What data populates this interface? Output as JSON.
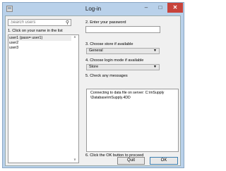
{
  "window": {
    "title": "Log-in",
    "controls": {
      "minimize": "–",
      "maximize": "□",
      "close": "✕"
    }
  },
  "search": {
    "placeholder": "Search users"
  },
  "user_list": {
    "heading": "1. Click on your name in the list",
    "users": [
      "user1 (pass= user1)",
      "user2",
      "user3"
    ],
    "selected_index": 0
  },
  "password": {
    "heading": "2. Enter your password",
    "value": ""
  },
  "store": {
    "heading": "3. Choose store if available",
    "selected": "General"
  },
  "login_mode": {
    "heading": "4. Choose login mode if available",
    "selected": "Store"
  },
  "messages": {
    "heading": "5. Check any messages",
    "lines": [
      "Connecting to data file on server: C:\\mSupply",
      "\\Database\\mSupply.4DD"
    ]
  },
  "footer": {
    "instruction": "6. Click the OK button to proceed",
    "quit_label": "Quit",
    "ok_label": "OK"
  }
}
